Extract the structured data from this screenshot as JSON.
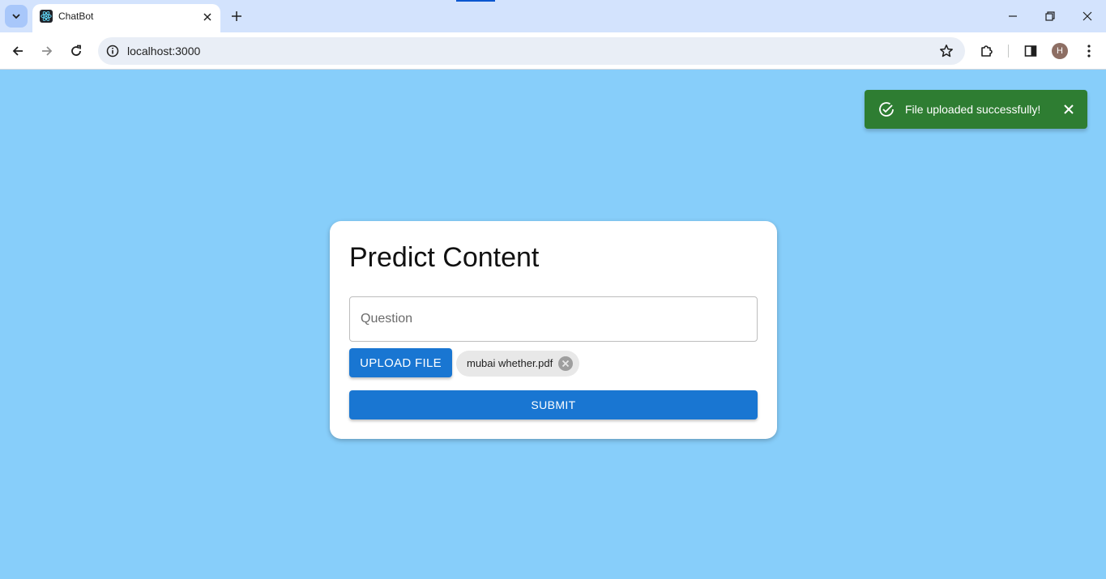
{
  "browser": {
    "tab_title": "ChatBot",
    "url": "localhost:3000",
    "profile_initial": "H"
  },
  "toast": {
    "message": "File uploaded successfully!",
    "severity": "success",
    "color": "#2e7d32"
  },
  "form": {
    "title": "Predict Content",
    "question_placeholder": "Question",
    "question_value": "",
    "upload_label": "UPLOAD FILE",
    "file_chip_label": "mubai whether.pdf",
    "submit_label": "SUBMIT"
  },
  "colors": {
    "page_background": "#87cefa",
    "primary": "#1976d2",
    "card": "#ffffff"
  },
  "icons": {
    "tab_search": "chevron-down-icon",
    "favicon": "react-icon",
    "tab_close": "close-icon",
    "new_tab": "plus-icon",
    "back": "arrow-left-icon",
    "forward": "arrow-right-icon",
    "reload": "reload-icon",
    "site_info": "info-icon",
    "bookmark": "star-icon",
    "extensions": "puzzle-icon",
    "side_panel": "side-panel-icon",
    "menu": "kebab-menu-icon",
    "toast_status": "check-circle-icon",
    "toast_close": "close-icon",
    "chip_delete": "cancel-circle-icon"
  }
}
